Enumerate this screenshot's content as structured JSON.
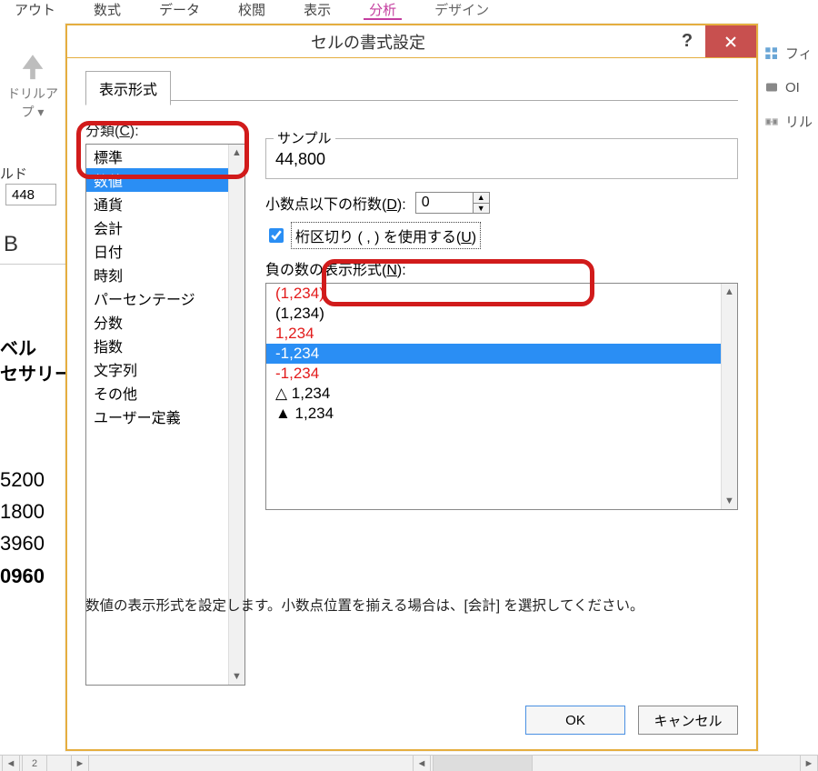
{
  "ribbon": {
    "tabs": [
      "アウト",
      "数式",
      "データ",
      "校閲",
      "表示",
      "分析",
      "デザイン"
    ],
    "active_index": 5
  },
  "drill": {
    "label1": "ドリルア",
    "label2": "プ"
  },
  "bg": {
    "field_label": "ルド",
    "input_value": "448",
    "big_B": "B",
    "side1": "ベル",
    "side2": "セサリー",
    "nums": [
      "5200",
      "1800",
      "3960",
      "0960"
    ],
    "bottom_num": "2"
  },
  "right_ribbon": {
    "t1": "フィ",
    "t2": "OI",
    "t3": "リル"
  },
  "dialog": {
    "title": "セルの書式設定",
    "tab": "表示形式",
    "cat_label_prefix": "分類(",
    "cat_label_key": "C",
    "cat_label_suffix": "):",
    "categories": [
      "標準",
      "数値",
      "通貨",
      "会計",
      "日付",
      "時刻",
      "パーセンテージ",
      "分数",
      "指数",
      "文字列",
      "その他",
      "ユーザー定義"
    ],
    "cat_selected_index": 1,
    "sample_label": "サンプル",
    "sample_value": "44,800",
    "decimals_label_prefix": "小数点以下の桁数(",
    "decimals_label_key": "D",
    "decimals_label_suffix": "):",
    "decimals_value": "0",
    "separator_checked": true,
    "separator_label_prefix": "桁区切り ( , ) を使用する(",
    "separator_label_key": "U",
    "separator_label_suffix": ")",
    "neg_label_prefix": "負の数の表示形式(",
    "neg_label_key": "N",
    "neg_label_suffix": "):",
    "neg_options": [
      {
        "text": "(1,234)",
        "class": "red"
      },
      {
        "text": "(1,234)",
        "class": ""
      },
      {
        "text": "1,234",
        "class": "red"
      },
      {
        "text": "-1,234",
        "class": "sel"
      },
      {
        "text": "-1,234",
        "class": "red"
      },
      {
        "text": "△ 1,234",
        "class": ""
      },
      {
        "text": "▲ 1,234",
        "class": ""
      }
    ],
    "hint": "数値の表示形式を設定します。小数点位置を揃える場合は、[会計] を選択してください。",
    "ok": "OK",
    "cancel": "キャンセル"
  }
}
